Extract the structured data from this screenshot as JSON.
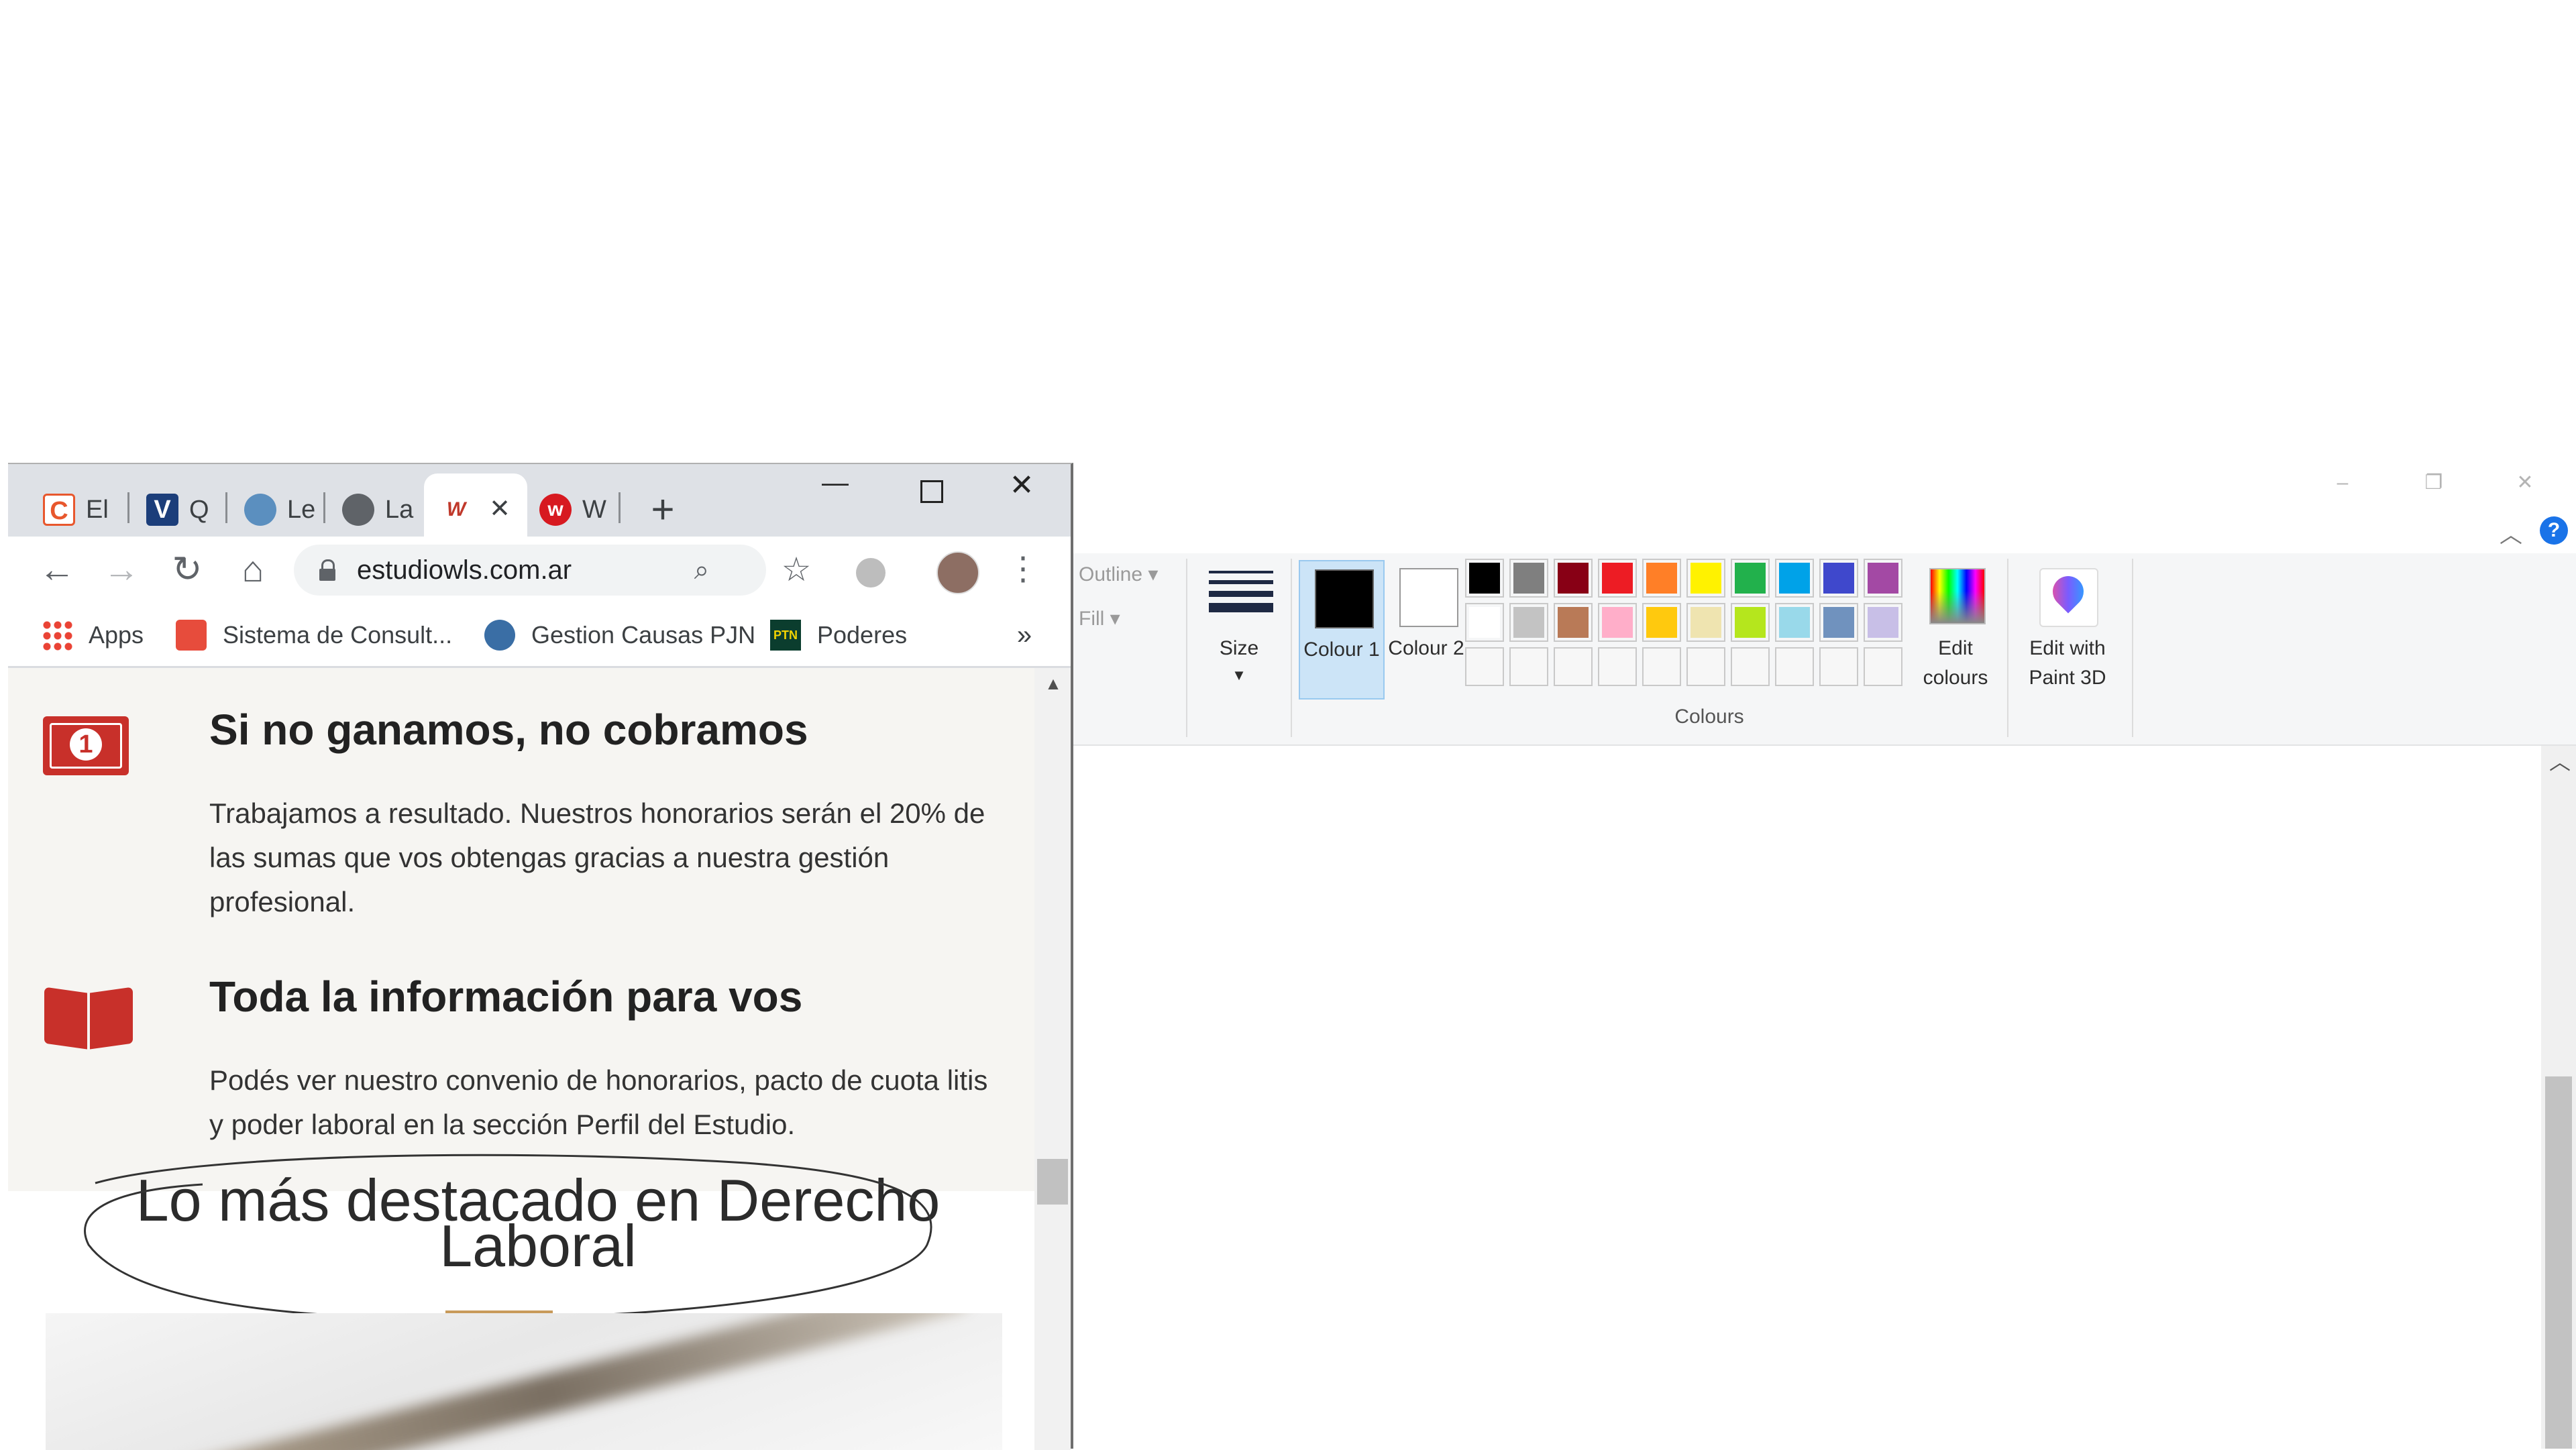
{
  "chrome": {
    "tabs": [
      {
        "title": "El",
        "favicon": "letter-c-favicon",
        "color": "#e8572d"
      },
      {
        "title": "Q",
        "favicon": "letter-v-favicon",
        "color": "#1c3e7a"
      },
      {
        "title": "Le",
        "favicon": "argentina-seal-favicon",
        "color": "#5b8fbf"
      },
      {
        "title": "La",
        "favicon": "globe-favicon",
        "color": "#5f6368"
      },
      {
        "title": "",
        "favicon": "wls-favicon",
        "color": "#c0392b",
        "active": true
      },
      {
        "title": "W",
        "favicon": "w-circle-favicon",
        "color": "#d71920"
      }
    ],
    "url": "estudiowls.com.ar",
    "bookmarks": [
      {
        "label": "Apps",
        "icon": "apps-grid-icon"
      },
      {
        "label": "Sistema de Consult...",
        "icon": "search-doc-icon"
      },
      {
        "label": "Gestion Causas PJN",
        "icon": "pjn-icon"
      },
      {
        "label": "Poderes",
        "icon": "ptn-icon"
      }
    ],
    "overflow_label": "»"
  },
  "webpage": {
    "feature1": {
      "heading": "Si no ganamos, no cobramos",
      "body": "Trabajamos a resultado. Nuestros honorarios serán el 20% de las sumas que vos obtengas gracias a nuestra gestión profesional."
    },
    "feature2": {
      "heading": "Toda la información para vos",
      "body": "Podés ver nuestro convenio de honorarios, pacto de cuota litis y poder laboral en la sección Perfil del Estudio."
    },
    "section_title": "Lo más destacado en Derecho Laboral",
    "accent_color": "#c8302a",
    "bill_value": "1"
  },
  "paint": {
    "outline_label": "Outline",
    "fill_label": "Fill",
    "size_label": "Size",
    "colour1_label": "Colour 1",
    "colour2_label": "Colour 2",
    "colours_group_label": "Colours",
    "edit_colours_label": "Edit colours",
    "edit_paint3d_label": "Edit with Paint 3D",
    "help_label": "?",
    "palette_row1": [
      "#000000",
      "#7f7f7f",
      "#880015",
      "#ed1c24",
      "#ff7f27",
      "#fff200",
      "#22b14c",
      "#00a2e8",
      "#3f48cc",
      "#a349a4"
    ],
    "palette_row2": [
      "#ffffff",
      "#c3c3c3",
      "#b97a57",
      "#ffaec9",
      "#ffc90e",
      "#efe4b0",
      "#b5e61d",
      "#99d9ea",
      "#7092be",
      "#c8bfe7"
    ]
  }
}
